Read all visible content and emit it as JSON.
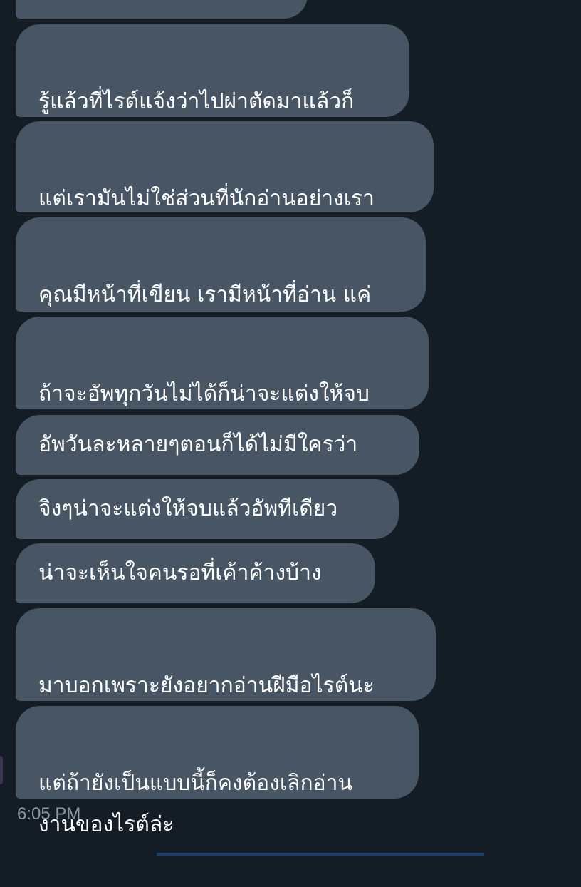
{
  "colors": {
    "background": "#141d26",
    "bubble": "#475564",
    "text": "#ffffff",
    "timestamp": "#8899a6"
  },
  "messages": [
    {
      "text": ""
    },
    {
      "text": "รู้แล้วที่ไรต์แจ้งว่าไปผ่าตัดมาแล้วก็\nเป็นโควิดต่ออีก"
    },
    {
      "text": "แต่เรามันไม่ใช่ส่วนที่นักอ่านอย่างเรา\nต้องสนอะ"
    },
    {
      "text": "คุณมีหน้าที่เขียน เรามีหน้าที่อ่าน แค่\nนั้น"
    },
    {
      "text": "ถ้าจะอัพทุกวันไม่ได้ก็น่าจะแต่งให้จบ\nก่อนทั้งเรื่องแล้วค่อยอัพสิ"
    },
    {
      "text": "อัพวันละหลายๆตอนก็ได้ไม่มีใครว่า"
    },
    {
      "text": "จิงๆน่าจะแต่งให้จบแล้วอัพทีเดียว"
    },
    {
      "text": "น่าจะเห็นใจคนรอที่เค้าค้างบ้าง"
    },
    {
      "text": "มาบอกเพราะยังอยากอ่านฝีมือไรต์นะ\nคะ"
    },
    {
      "text": "แต่ถ้ายังเป็นแบบนี้ก็คงต้องเลิกอ่าน\nงานของไรต์ล่ะ"
    }
  ],
  "timestamp": "6:05 PM"
}
